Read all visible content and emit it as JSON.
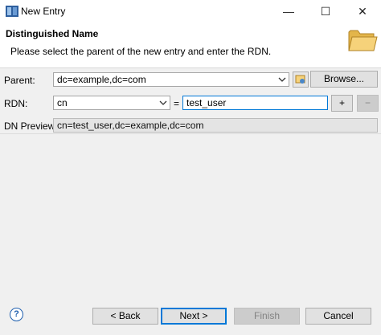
{
  "window": {
    "title": "New Entry",
    "minimize_glyph": "—",
    "maximize_glyph": "☐",
    "close_glyph": "✕"
  },
  "header": {
    "title": "Distinguished Name",
    "description": "Please select the parent of the new entry and enter the RDN.",
    "icon": "folder-icon"
  },
  "form": {
    "parent": {
      "label": "Parent:",
      "value": "dc=example,dc=com",
      "browse_label": "Browse..."
    },
    "rdn": {
      "label": "RDN:",
      "attribute": "cn",
      "equals": "=",
      "value": "test_user",
      "add_label": "+",
      "remove_label": "−"
    },
    "dn_preview": {
      "label": "DN Preview:",
      "value": "cn=test_user,dc=example,dc=com"
    }
  },
  "footer": {
    "help_glyph": "?",
    "back_label": "< Back",
    "next_label": "Next >",
    "finish_label": "Finish",
    "cancel_label": "Cancel"
  },
  "colors": {
    "accent": "#0078d7",
    "window_bg": "#f0f0f0",
    "header_bg": "#ffffff",
    "disabled_text": "#838383"
  }
}
